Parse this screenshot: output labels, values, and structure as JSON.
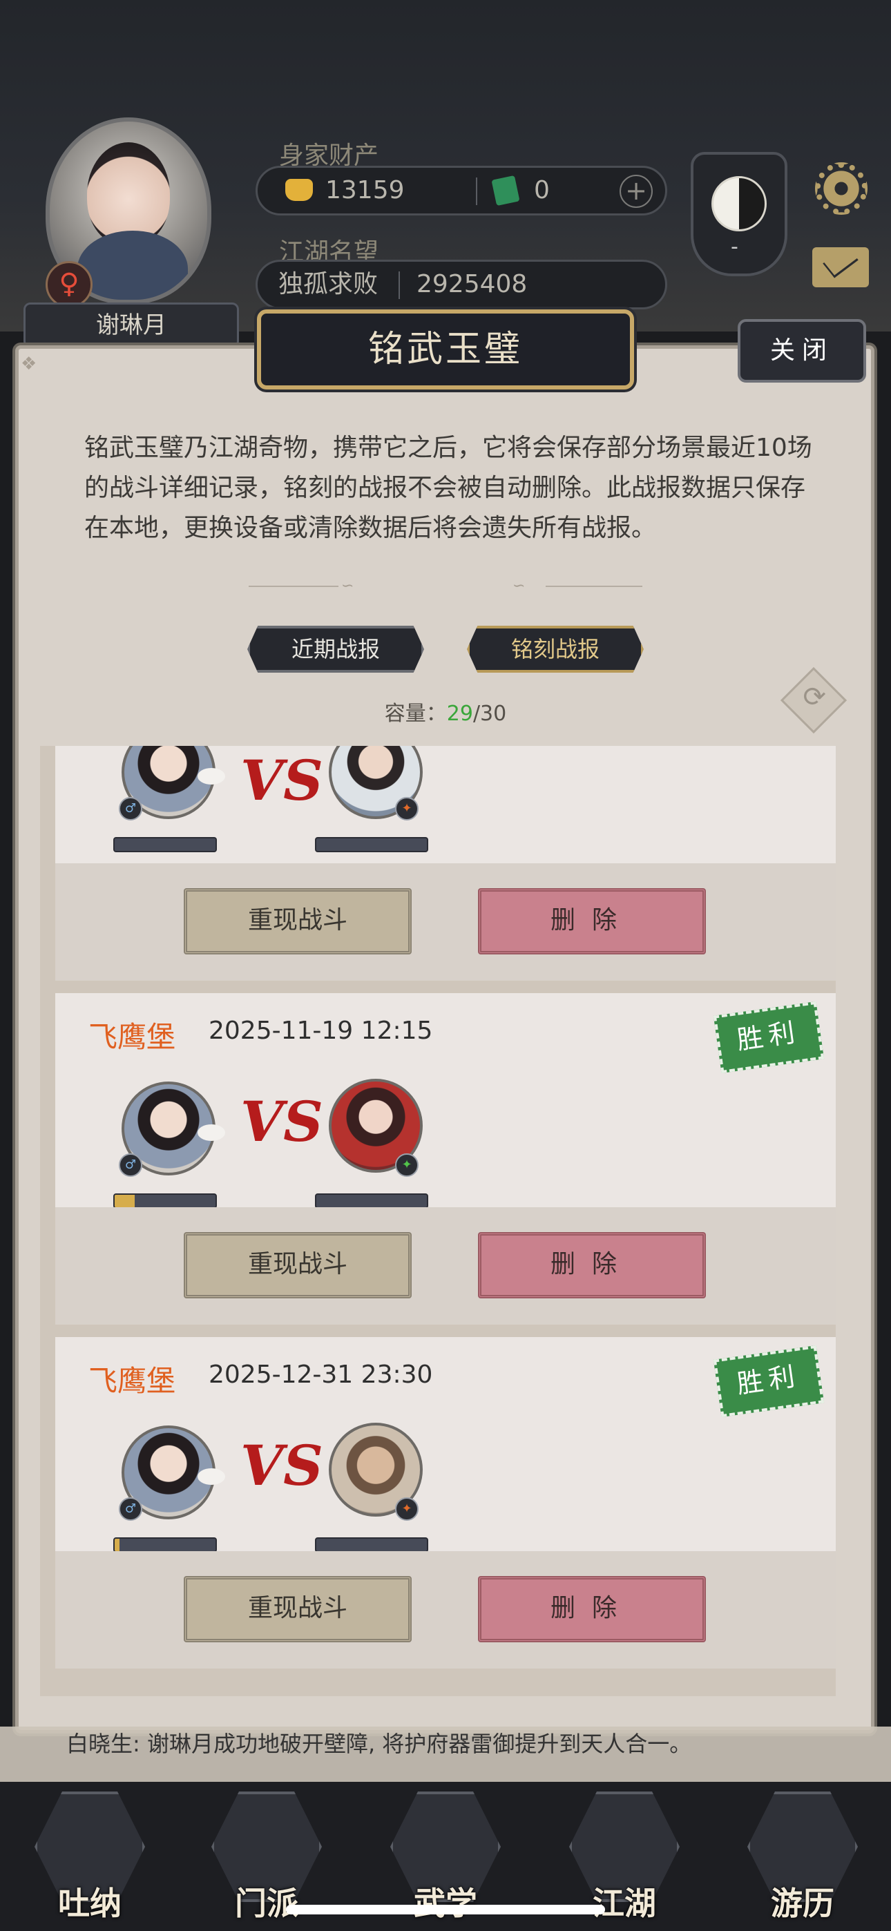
{
  "player": {
    "name": "谢琳月",
    "gender_symbol": "♀"
  },
  "wealth": {
    "label": "身家财产",
    "gold": "13159",
    "jade": "0",
    "plus": "+"
  },
  "reputation": {
    "label": "江湖名望",
    "title": "独孤求败",
    "value": "2925408"
  },
  "taiji_dash": "-",
  "modal": {
    "title": "铭武玉璧",
    "close_label": "关闭",
    "intro": "铭武玉璧乃江湖奇物，携带它之后，它将会保存部分场景最近10场的战斗详细记录，铭刻的战报不会被自动删除。此战报数据只保存在本地，更换设备或清除数据后将会遗失所有战报。",
    "tabs": [
      {
        "label": "近期战报"
      },
      {
        "label": "铭刻战报"
      }
    ],
    "capacity_label": "容量：",
    "capacity_used": "29",
    "capacity_total": "/30"
  },
  "battles": [
    {
      "location": "",
      "time": "",
      "result": "",
      "player_hp": 0,
      "opponent_hp": 0,
      "replay_label": "重现战斗",
      "delete_label": "删除"
    },
    {
      "location": "飞鹰堡",
      "time": "2025-11-19 12:15",
      "result": "胜利",
      "player_hp": 0.2,
      "opponent_hp": 0,
      "replay_label": "重现战斗",
      "delete_label": "删除"
    },
    {
      "location": "飞鹰堡",
      "time": "2025-12-31 23:30",
      "result": "胜利",
      "player_hp": 0.05,
      "opponent_hp": 0,
      "replay_label": "重现战斗",
      "delete_label": "删除"
    }
  ],
  "vs_label": "VS",
  "feed": {
    "line": "白晓生: 谢琳月成功地破开壁障, 将护府器雷御提升到天人合一。"
  },
  "nav": [
    {
      "label": "吐纳"
    },
    {
      "label": "门派"
    },
    {
      "label": "武学"
    },
    {
      "label": "江湖"
    },
    {
      "label": "游历"
    }
  ],
  "colors": {
    "accent_gold": "#c7a868",
    "capacity_used": "#3aa63a",
    "location": "#e06020",
    "victory": "#3a8c48",
    "delete": "#c9818d"
  }
}
